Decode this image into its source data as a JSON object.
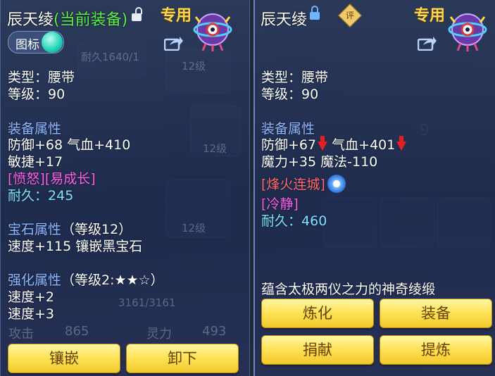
{
  "left": {
    "title": "辰天绫",
    "current_tag": "(当前装备)",
    "zhuanyong": "专用",
    "toggle_label": "图标",
    "type_line": "类型：腰带",
    "level_line": "等级：90",
    "equip_attr_header": "装备属性",
    "attr_line1": "防御+68 气血+410",
    "attr_line2": "敏捷+17",
    "special": "[愤怒][易成长]",
    "durability_label": "耐久：",
    "durability_value": "245",
    "gem_header": "宝石属性",
    "gem_level": "（等级12）",
    "gem_line": "速度+115 镶嵌黑宝石",
    "strengthen_header": "强化属性",
    "strengthen_level": "（等级2:★★☆）",
    "strengthen_line1": "速度+2",
    "strengthen_line2": "速度+3",
    "btn_inlay": "镶嵌",
    "btn_unequip": "卸下"
  },
  "right": {
    "title": "辰天绫",
    "ping": "评",
    "zhuanyong": "专用",
    "type_line": "类型：腰带",
    "level_line": "等级：90",
    "equip_attr_header": "装备属性",
    "def_text": "防御+67",
    "hp_text": "气血+401",
    "attr_line2": "魔力+35 魔法-110",
    "skill": "[烽火连城]",
    "special": "[冷静]",
    "durability_label": "耐久：",
    "durability_value": "460",
    "description": "蕴含太极两仪之力的神奇绫缎",
    "btn_refine": "炼化",
    "btn_equip": "装备",
    "btn_donate": "捐献",
    "btn_extract": "提炼"
  },
  "background": {
    "ghost_durability": "耐久1640/1",
    "ghost_level1": "12级",
    "ghost_level2": "12级",
    "ghost_level3": "12级",
    "ghost_hp": "3161/3161",
    "ghost_attack_label": "攻击",
    "ghost_attack_value": "865",
    "ghost_spirit_label": "灵力",
    "ghost_spirit_value": "493",
    "ghost_num": "9"
  },
  "colors": {
    "current_tag": "#59f04a",
    "section_header": "#8fb8ff",
    "durability_value": "#7fe3ff",
    "special_text": "#ff5fe6",
    "skill_text": "#ff6a6a",
    "button_yellow": "#ffe45a",
    "zhuanyong": "#ffd84a"
  },
  "icons": [
    "lock-open-icon",
    "lock-closed-icon",
    "share-icon",
    "belt-emblem-icon",
    "down-arrow-icon",
    "swirl-skill-icon",
    "rating-icon"
  ]
}
